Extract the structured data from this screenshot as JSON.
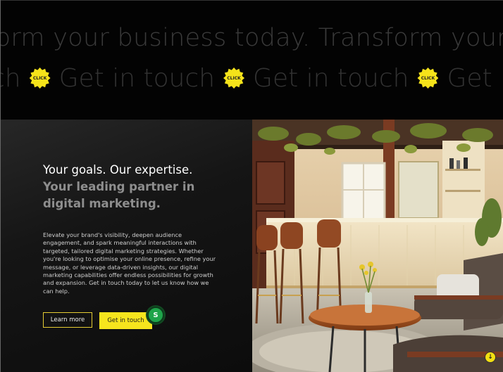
{
  "marquee": {
    "line1": "form your business today. Transform your b",
    "line2_fragments": [
      "ch",
      "Get in touch",
      "Get in touch",
      "Get in t"
    ],
    "badge_label": "CLICK"
  },
  "hero": {
    "title": "Your goals. Our expertise.",
    "subtitle": "Your leading partner in digital marketing.",
    "body": "Elevate your brand's visibility, deepen audience engagement, and spark meaningful interactions with targeted, tailored digital marketing strategies. Whether you're looking to optimise your online presence, refine your message, or leverage data-driven insights, our digital marketing capabilities offer endless possibilities for growth and expansion. Get in touch today to let us know how we can help.",
    "learn_more_label": "Learn more",
    "get_in_touch_label": "Get in touch",
    "avatar_initial": "S"
  },
  "scroll_indicator": "↓",
  "colors": {
    "accent": "#f6e51d",
    "avatar": "#1fa44a",
    "background": "#000000"
  }
}
